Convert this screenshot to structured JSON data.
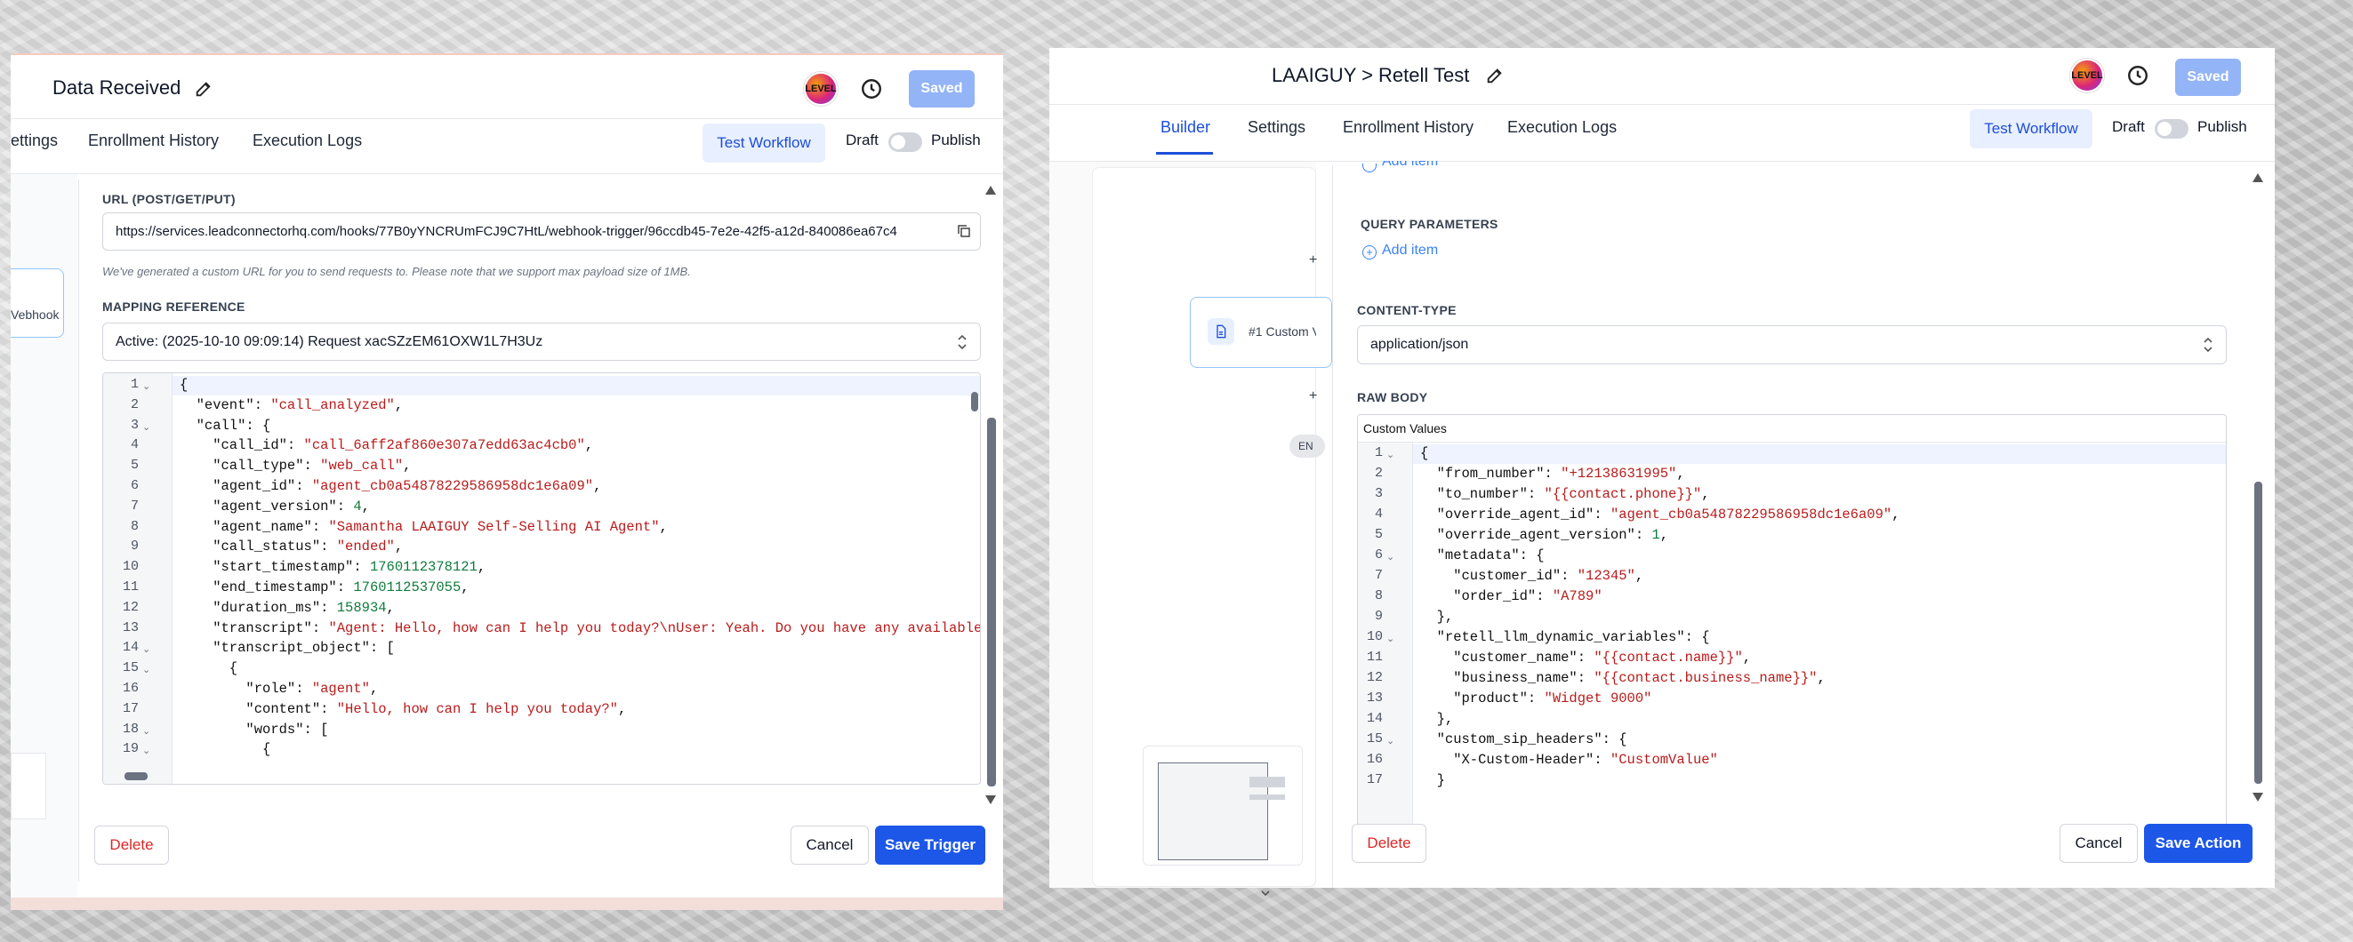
{
  "left": {
    "title": "Data Received",
    "avatar_text": "LEVEL",
    "saved_label": "Saved",
    "tabs": [
      "ettings",
      "Enrollment History",
      "Execution Logs"
    ],
    "test_workflow_label": "Test Workflow",
    "draft_label": "Draft",
    "publish_label": "Publish",
    "side_node_label": "Vebhook",
    "url_label": "URL (POST/GET/PUT)",
    "url_value": "https://services.leadconnectorhq.com/hooks/77B0yYNCRUmFCJ9C7HtL/webhook-trigger/96ccdb45-7e2e-42f5-a12d-840086ea67c4",
    "url_help": "We've generated a custom URL for you to send requests to. Please note that we support max payload size of 1MB.",
    "mapping_label": "MAPPING REFERENCE",
    "mapping_value": "Active: (2025-10-10 09:09:14) Request xacSZzEM61OXW1L7H3Uz",
    "code_lines": [
      {
        "n": "1",
        "f": true,
        "t": [
          [
            "{",
            "k"
          ]
        ]
      },
      {
        "n": "2",
        "t": [
          [
            "  \"event\": ",
            "k"
          ],
          [
            "\"call_analyzed\"",
            "s"
          ],
          [
            ",",
            "k"
          ]
        ]
      },
      {
        "n": "3",
        "f": true,
        "t": [
          [
            "  \"call\": {",
            "k"
          ]
        ]
      },
      {
        "n": "4",
        "t": [
          [
            "    \"call_id\": ",
            "k"
          ],
          [
            "\"call_6aff2af860e307a7edd63ac4cb0\"",
            "s"
          ],
          [
            ",",
            "k"
          ]
        ]
      },
      {
        "n": "5",
        "t": [
          [
            "    \"call_type\": ",
            "k"
          ],
          [
            "\"web_call\"",
            "s"
          ],
          [
            ",",
            "k"
          ]
        ]
      },
      {
        "n": "6",
        "t": [
          [
            "    \"agent_id\": ",
            "k"
          ],
          [
            "\"agent_cb0a54878229586958dc1e6a09\"",
            "s"
          ],
          [
            ",",
            "k"
          ]
        ]
      },
      {
        "n": "7",
        "t": [
          [
            "    \"agent_version\": ",
            "k"
          ],
          [
            "4",
            "n"
          ],
          [
            ",",
            "k"
          ]
        ]
      },
      {
        "n": "8",
        "t": [
          [
            "    \"agent_name\": ",
            "k"
          ],
          [
            "\"Samantha LAAIGUY Self-Selling AI Agent\"",
            "s"
          ],
          [
            ",",
            "k"
          ]
        ]
      },
      {
        "n": "9",
        "t": [
          [
            "    \"call_status\": ",
            "k"
          ],
          [
            "\"ended\"",
            "s"
          ],
          [
            ",",
            "k"
          ]
        ]
      },
      {
        "n": "10",
        "t": [
          [
            "    \"start_timestamp\": ",
            "k"
          ],
          [
            "1760112378121",
            "n"
          ],
          [
            ",",
            "k"
          ]
        ]
      },
      {
        "n": "11",
        "t": [
          [
            "    \"end_timestamp\": ",
            "k"
          ],
          [
            "1760112537055",
            "n"
          ],
          [
            ",",
            "k"
          ]
        ]
      },
      {
        "n": "12",
        "t": [
          [
            "    \"duration_ms\": ",
            "k"
          ],
          [
            "158934",
            "n"
          ],
          [
            ",",
            "k"
          ]
        ]
      },
      {
        "n": "13",
        "t": [
          [
            "    \"transcript\": ",
            "k"
          ],
          [
            "\"Agent: Hello, how can I help you today?\\nUser: Yeah. Do you have any available c",
            "s"
          ]
        ]
      },
      {
        "n": "14",
        "f": true,
        "t": [
          [
            "    \"transcript_object\": [",
            "k"
          ]
        ]
      },
      {
        "n": "15",
        "f": true,
        "t": [
          [
            "      {",
            "k"
          ]
        ]
      },
      {
        "n": "16",
        "t": [
          [
            "        \"role\": ",
            "k"
          ],
          [
            "\"agent\"",
            "s"
          ],
          [
            ",",
            "k"
          ]
        ]
      },
      {
        "n": "17",
        "t": [
          [
            "        \"content\": ",
            "k"
          ],
          [
            "\"Hello, how can I help you today?\"",
            "s"
          ],
          [
            ",",
            "k"
          ]
        ]
      },
      {
        "n": "18",
        "f": true,
        "t": [
          [
            "        \"words\": [",
            "k"
          ]
        ]
      },
      {
        "n": "19",
        "f": true,
        "t": [
          [
            "          {",
            "k"
          ]
        ]
      }
    ],
    "delete_label": "Delete",
    "cancel_label": "Cancel",
    "save_label": "Save Trigger"
  },
  "right": {
    "title": "LAAIGUY > Retell Test",
    "avatar_text": "LEVEL",
    "saved_label": "Saved",
    "tabs": [
      "Builder",
      "Settings",
      "Enrollment History",
      "Execution Logs"
    ],
    "test_workflow_label": "Test Workflow",
    "draft_label": "Draft",
    "publish_label": "Publish",
    "add_item_top": "Add item",
    "query_label": "QUERY PARAMETERS",
    "add_item_label": "Add item",
    "node_label": "#1 Custom V",
    "node_badge": "EN",
    "content_type_label": "CONTENT-TYPE",
    "content_type_value": "application/json",
    "raw_body_label": "RAW BODY",
    "custom_values_label": "Custom Values",
    "code_lines": [
      {
        "n": "1",
        "f": true,
        "t": [
          [
            "{",
            "k"
          ]
        ]
      },
      {
        "n": "2",
        "t": [
          [
            "  \"from_number\": ",
            "k"
          ],
          [
            "\"+12138631995\"",
            "s"
          ],
          [
            ",",
            "k"
          ]
        ]
      },
      {
        "n": "3",
        "t": [
          [
            "  \"to_number\": ",
            "k"
          ],
          [
            "\"{{contact.phone}}\"",
            "s"
          ],
          [
            ",",
            "k"
          ]
        ]
      },
      {
        "n": "4",
        "t": [
          [
            "  \"override_agent_id\": ",
            "k"
          ],
          [
            "\"agent_cb0a54878229586958dc1e6a09\"",
            "s"
          ],
          [
            ",",
            "k"
          ]
        ]
      },
      {
        "n": "5",
        "t": [
          [
            "  \"override_agent_version\": ",
            "k"
          ],
          [
            "1",
            "n"
          ],
          [
            ",",
            "k"
          ]
        ]
      },
      {
        "n": "6",
        "f": true,
        "t": [
          [
            "  \"metadata\": {",
            "k"
          ]
        ]
      },
      {
        "n": "7",
        "t": [
          [
            "    \"customer_id\": ",
            "k"
          ],
          [
            "\"12345\"",
            "s"
          ],
          [
            ",",
            "k"
          ]
        ]
      },
      {
        "n": "8",
        "t": [
          [
            "    \"order_id\": ",
            "k"
          ],
          [
            "\"A789\"",
            "s"
          ]
        ]
      },
      {
        "n": "9",
        "t": [
          [
            "  },",
            "k"
          ]
        ]
      },
      {
        "n": "10",
        "f": true,
        "t": [
          [
            "  \"retell_llm_dynamic_variables\": {",
            "k"
          ]
        ]
      },
      {
        "n": "11",
        "t": [
          [
            "    \"customer_name\": ",
            "k"
          ],
          [
            "\"{{contact.name}}\"",
            "s"
          ],
          [
            ",",
            "k"
          ]
        ]
      },
      {
        "n": "12",
        "t": [
          [
            "    \"business_name\": ",
            "k"
          ],
          [
            "\"{{contact.business_name}}\"",
            "s"
          ],
          [
            ",",
            "k"
          ]
        ]
      },
      {
        "n": "13",
        "t": [
          [
            "    \"product\": ",
            "k"
          ],
          [
            "\"Widget 9000\"",
            "s"
          ]
        ]
      },
      {
        "n": "14",
        "t": [
          [
            "  },",
            "k"
          ]
        ]
      },
      {
        "n": "15",
        "f": true,
        "t": [
          [
            "  \"custom_sip_headers\": {",
            "k"
          ]
        ]
      },
      {
        "n": "16",
        "t": [
          [
            "    \"X-Custom-Header\": ",
            "k"
          ],
          [
            "\"CustomValue\"",
            "s"
          ]
        ]
      },
      {
        "n": "17",
        "t": [
          [
            "  }",
            "k"
          ]
        ]
      }
    ],
    "delete_label": "Delete",
    "cancel_label": "Cancel",
    "save_label": "Save Action"
  }
}
